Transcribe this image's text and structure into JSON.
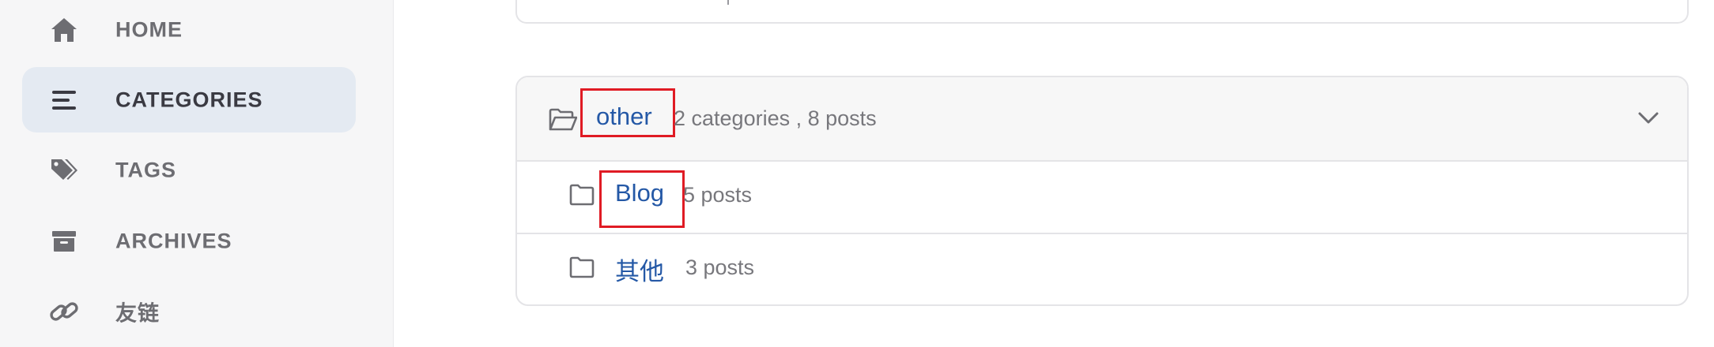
{
  "sidebar": {
    "items": [
      {
        "label": "HOME",
        "icon": "home-icon",
        "active": false
      },
      {
        "label": "CATEGORIES",
        "icon": "list-icon",
        "active": true
      },
      {
        "label": "TAGS",
        "icon": "tags-icon",
        "active": false
      },
      {
        "label": "ARCHIVES",
        "icon": "archive-icon",
        "active": false
      },
      {
        "label": "友链",
        "icon": "link-icon",
        "active": false
      }
    ]
  },
  "category": {
    "name": "other",
    "meta": "2 categories , 8 posts",
    "icon": "folder-open-icon",
    "toggle_icon": "chevron-down-icon",
    "subcategories": [
      {
        "name": "Blog",
        "meta": "5 posts",
        "icon": "folder-icon"
      },
      {
        "name": "其他",
        "meta": "3 posts",
        "icon": "folder-icon"
      }
    ]
  },
  "colors": {
    "link": "#2458a6",
    "highlight": "#e01b24",
    "active_bg": "#e4eaf2",
    "sidebar_bg": "#f6f6f7"
  }
}
